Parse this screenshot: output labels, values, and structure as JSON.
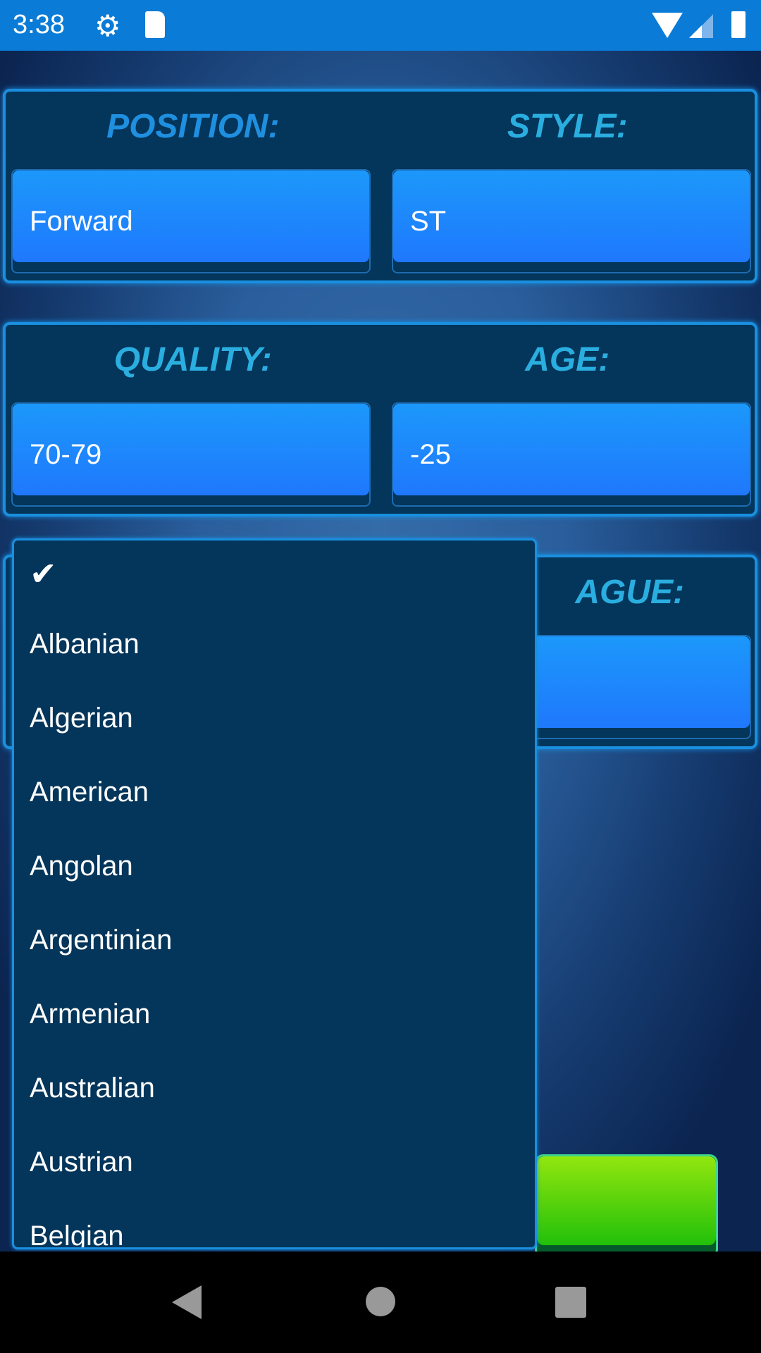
{
  "status_bar": {
    "time": "3:38",
    "icons": [
      "gear-icon",
      "sd-card-icon",
      "wifi-icon",
      "signal-icon",
      "battery-icon"
    ]
  },
  "filters": {
    "position": {
      "label": "POSITION:",
      "value": "Forward"
    },
    "style": {
      "label": "STYLE:",
      "value": "ST"
    },
    "quality": {
      "label": "QUALITY:",
      "value": "70-79"
    },
    "age": {
      "label": "AGE:",
      "value": "-25"
    },
    "league": {
      "label_visible": "AGUE:",
      "value": ""
    }
  },
  "dropdown": {
    "selected_mark": "✔",
    "items": [
      "Albanian",
      "Algerian",
      "American",
      "Angolan",
      "Argentinian",
      "Armenian",
      "Australian",
      "Austrian",
      "Belgian"
    ]
  },
  "colors": {
    "accent": "#1a8fdf",
    "button": "#1c98fb",
    "go_button": "#22c00a",
    "panel": "#04355a"
  },
  "nav_bar": {
    "icons": [
      "back-icon",
      "home-icon",
      "recents-icon"
    ]
  }
}
